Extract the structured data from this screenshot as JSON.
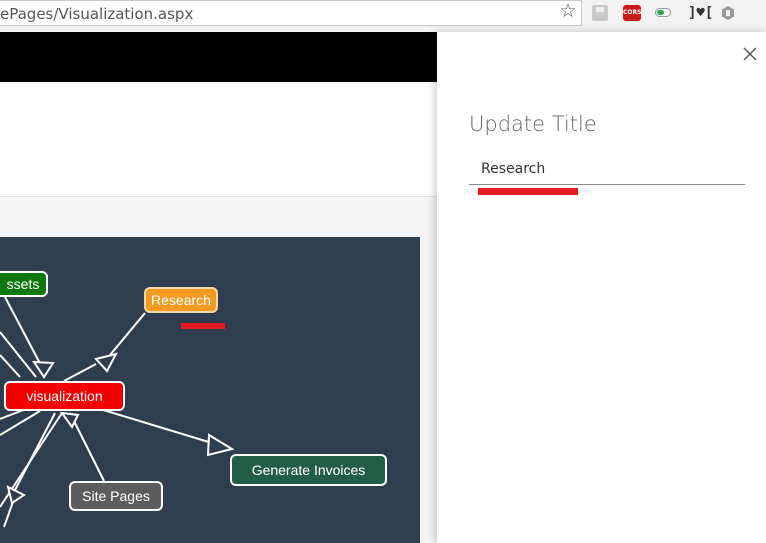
{
  "browser": {
    "url": "ePages/Visualization.aspx",
    "icons": {
      "bookmark": "star-icon",
      "extensions": [
        "save-extension-icon",
        "cors-extension-icon",
        "toggle-extension-icon",
        "bracket-extension-icon",
        "hexagon-extension-icon"
      ]
    },
    "cors_label": "CORS"
  },
  "visualization": {
    "nodes": {
      "assets": "ssets",
      "research": "Research",
      "visualization": "visualization",
      "generate_invoices": "Generate Invoices",
      "site_pages": "Site Pages"
    },
    "colors": {
      "canvas": "#2e3e4f",
      "assets": "#0b7a0b",
      "research": "#f39b21",
      "visualization": "#f20000",
      "generate_invoices": "#225e47",
      "site_pages": "#5d5d5d",
      "highlight": "#e41b23"
    }
  },
  "panel": {
    "title": "Update Title",
    "input_value": "Research",
    "close_icon": "close-icon"
  }
}
